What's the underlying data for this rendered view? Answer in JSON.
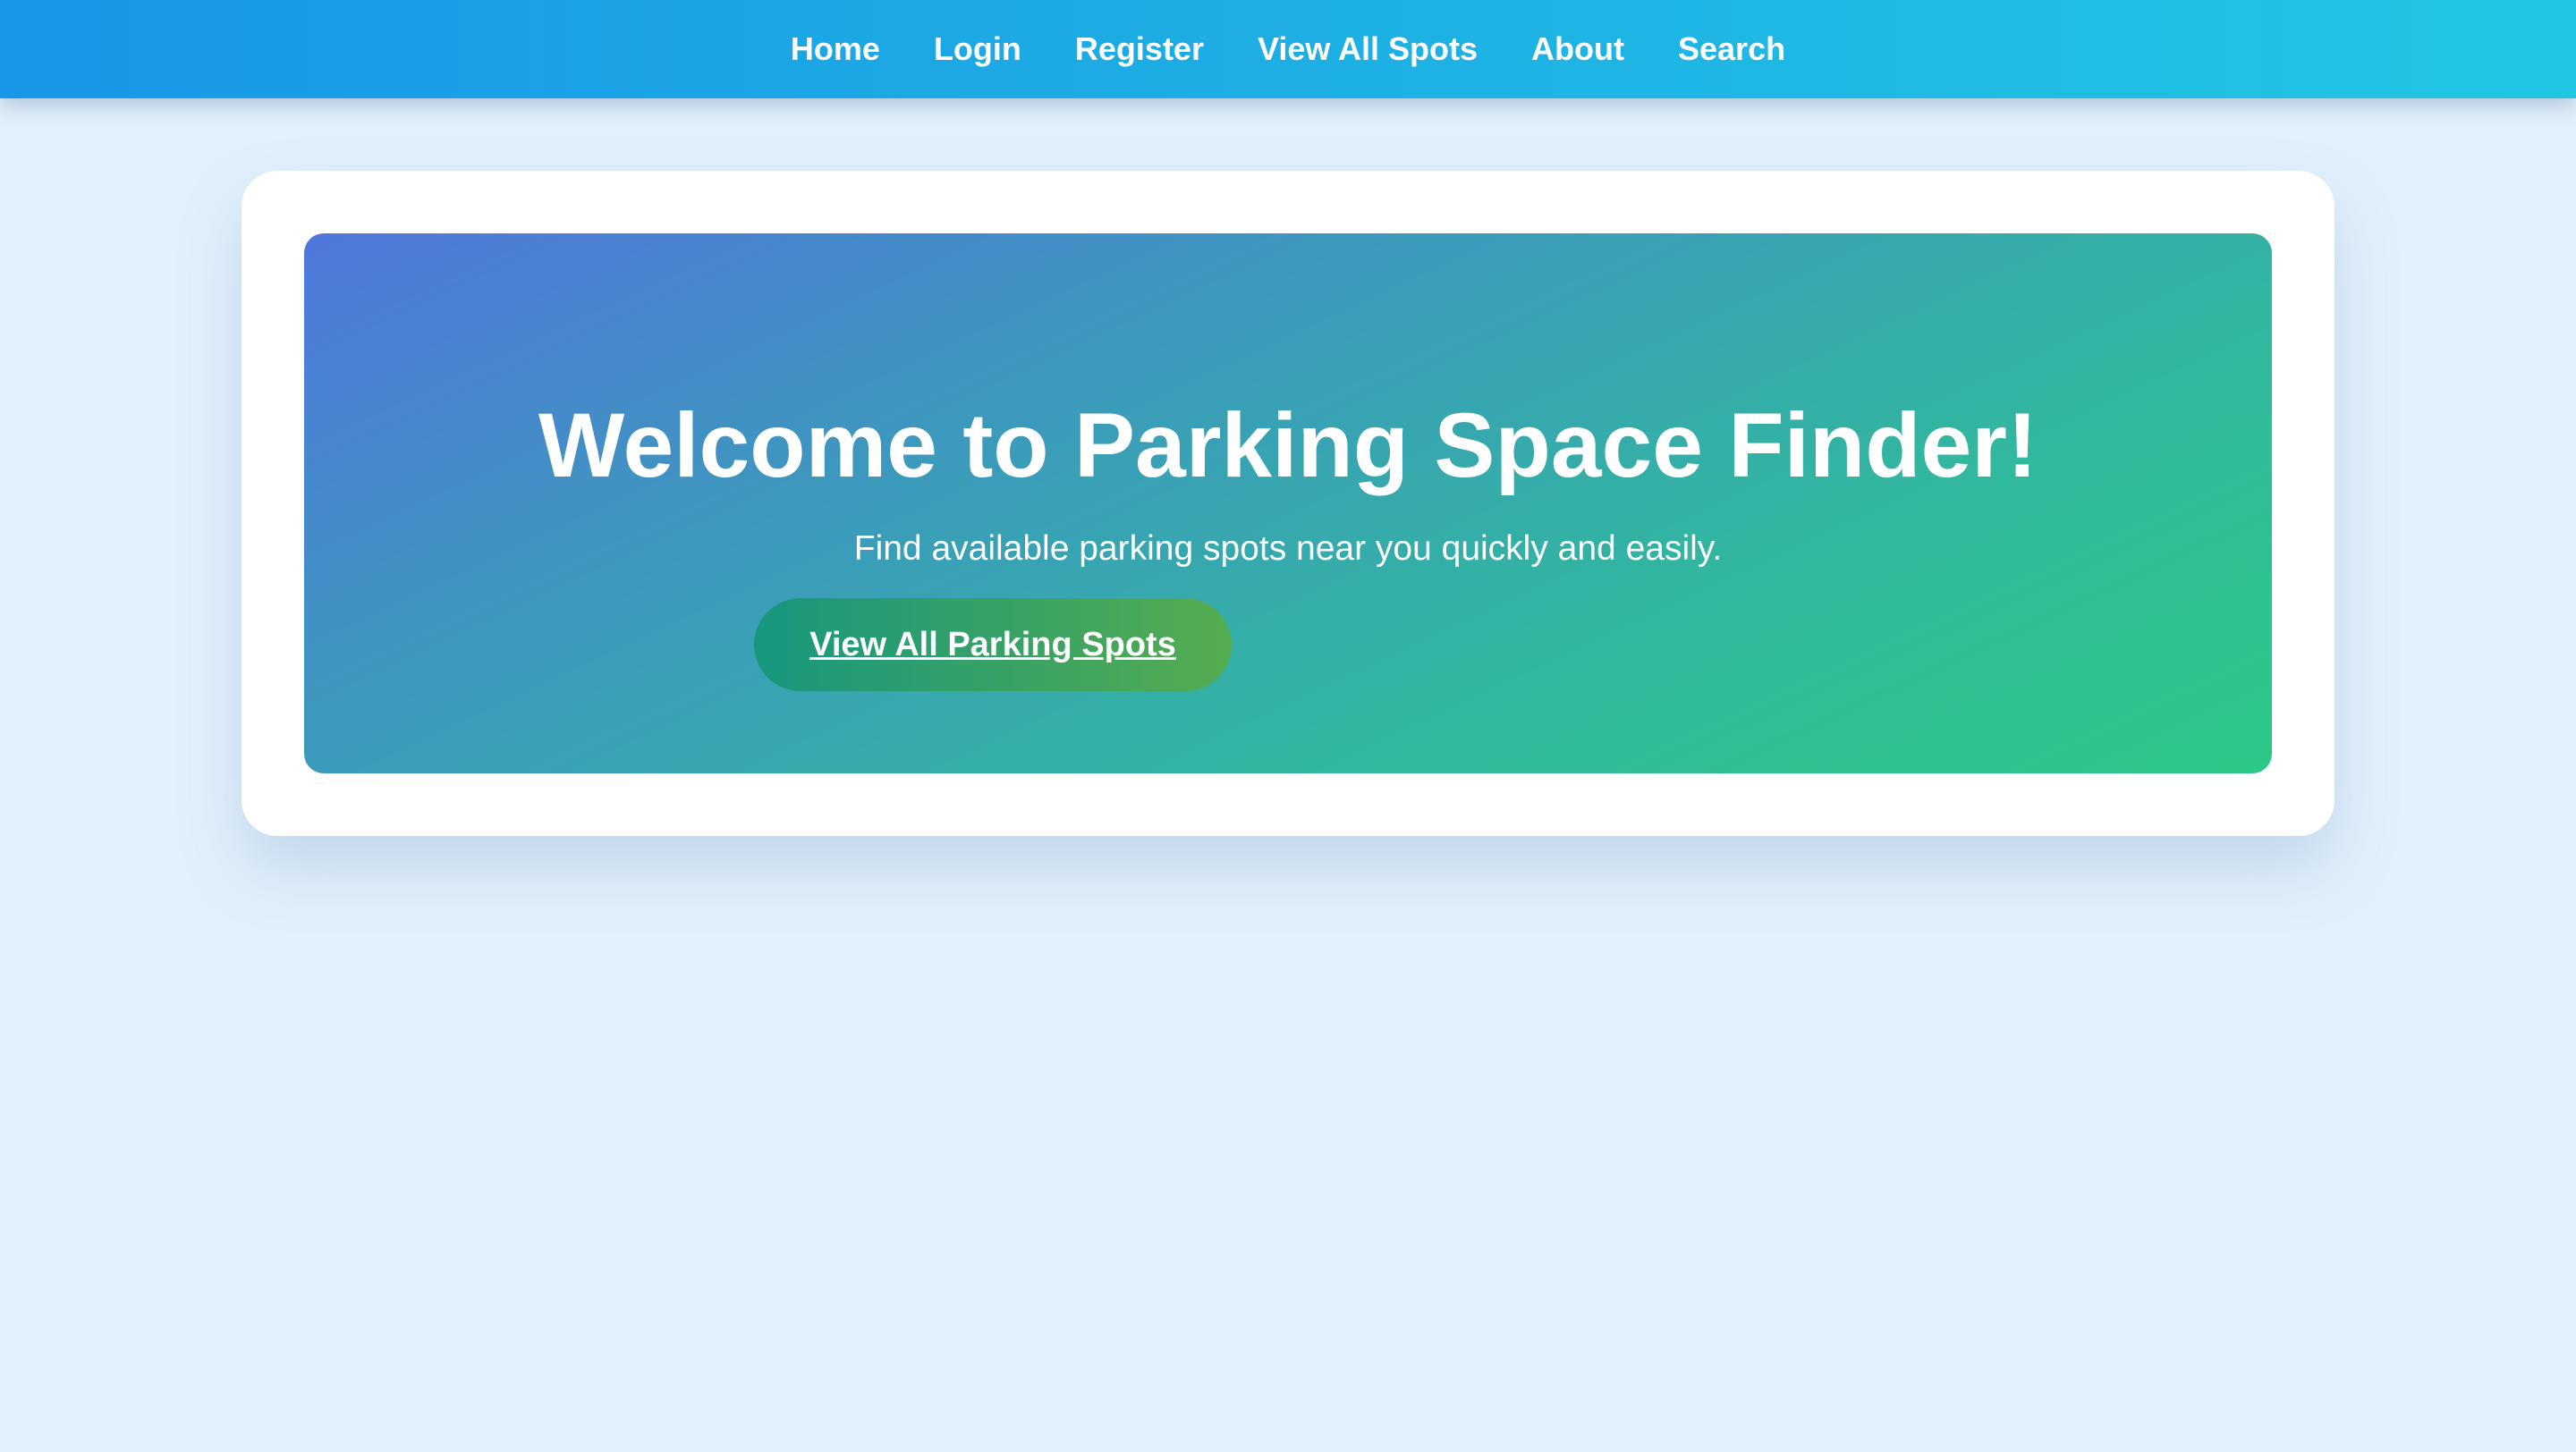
{
  "nav": {
    "items": [
      {
        "label": "Home"
      },
      {
        "label": "Login"
      },
      {
        "label": "Register"
      },
      {
        "label": "View All Spots"
      },
      {
        "label": "About"
      },
      {
        "label": "Search"
      }
    ]
  },
  "hero": {
    "title": "Welcome to Parking Space Finder!",
    "subtitle": "Find available parking spots near you quickly and easily.",
    "button_label": "View All Parking Spots"
  },
  "colors": {
    "page_background": "#e2f0fb",
    "nav_gradient_start": "#1897e6",
    "nav_gradient_end": "#22c6e3",
    "hero_gradient_start": "#5077dc",
    "hero_gradient_end": "#2cc886",
    "button_gradient_start": "#17977f",
    "button_gradient_end": "#55ac4f"
  }
}
